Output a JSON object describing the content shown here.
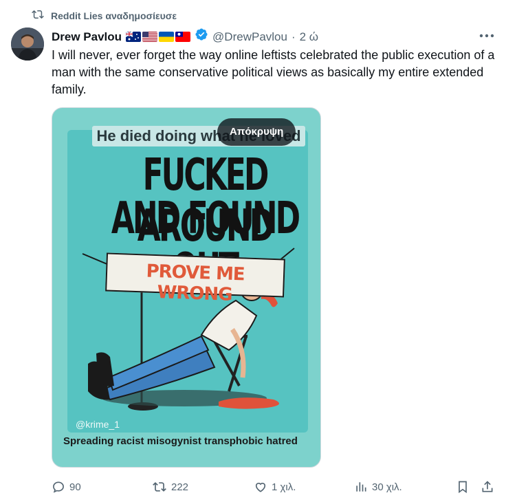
{
  "repost": {
    "label": "Reddit Lies αναδημοσίευσε",
    "icon": "repost-icon"
  },
  "author": {
    "name": "Drew Pavlou",
    "flags": [
      "australia-flag",
      "usa-flag",
      "ukraine-flag",
      "taiwan-flag"
    ],
    "verified": true,
    "handle": "@DrewPavlou",
    "separator": "·",
    "time": "2 ώ"
  },
  "tweet": {
    "text": "I will never, ever forget the way online leftists celebrated the public execution of a man with the same conservative political views as basically my entire extended family."
  },
  "media": {
    "top_caption": "He died doing what he loved",
    "hide_label": "Απόκρυψη",
    "headline_line1": "FUCKED AROUND",
    "headline_line2": "AND FOUND OUT",
    "banner": "PROVE ME WRONG",
    "credit": "@krime_1",
    "subcaption": "Spreading racist misogynist transphobic hatred"
  },
  "actions": {
    "replies": "90",
    "reposts": "222",
    "likes": "1 χιλ.",
    "views": "30 χιλ."
  },
  "colors": {
    "text": "#0f1419",
    "secondary": "#536471",
    "verified": "#1d9bf0",
    "media_bg": "#56c3c1"
  }
}
